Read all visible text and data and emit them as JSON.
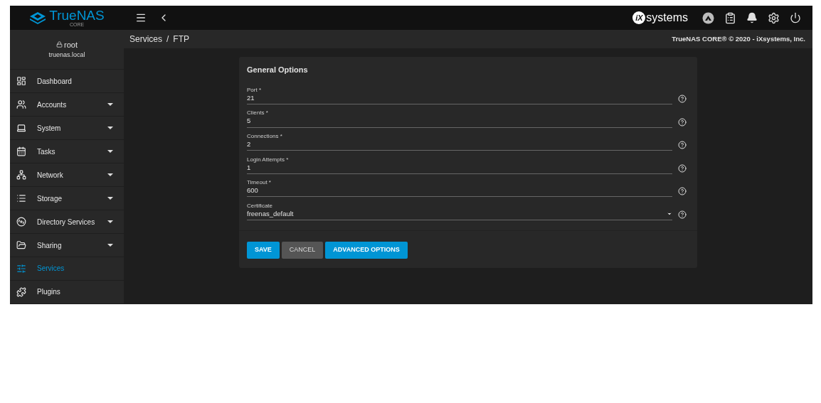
{
  "topbar": {
    "logo_text": "TrueNAS",
    "logo_subtext": "CORE",
    "vendor_text": "iX",
    "vendor_suffix": "systems"
  },
  "user": {
    "name": "root",
    "host": "truenas.local"
  },
  "sidebar": {
    "items": [
      {
        "label": "Dashboard",
        "has_submenu": false,
        "selected": false
      },
      {
        "label": "Accounts",
        "has_submenu": true,
        "selected": false
      },
      {
        "label": "System",
        "has_submenu": true,
        "selected": false
      },
      {
        "label": "Tasks",
        "has_submenu": true,
        "selected": false
      },
      {
        "label": "Network",
        "has_submenu": true,
        "selected": false
      },
      {
        "label": "Storage",
        "has_submenu": true,
        "selected": false
      },
      {
        "label": "Directory Services",
        "has_submenu": true,
        "selected": false
      },
      {
        "label": "Sharing",
        "has_submenu": true,
        "selected": false
      },
      {
        "label": "Services",
        "has_submenu": false,
        "selected": true
      },
      {
        "label": "Plugins",
        "has_submenu": false,
        "selected": false
      }
    ]
  },
  "breadcrumb": {
    "separator": "/",
    "items": [
      "Services",
      "FTP"
    ]
  },
  "copyright": "TrueNAS CORE® © 2020 - iXsystems, Inc.",
  "form": {
    "title": "General Options",
    "fields": [
      {
        "kind": "input",
        "label": "Port *",
        "value": "21"
      },
      {
        "kind": "input",
        "label": "Clients *",
        "value": "5"
      },
      {
        "kind": "input",
        "label": "Connections *",
        "value": "2"
      },
      {
        "kind": "input",
        "label": "Login Attempts *",
        "value": "1"
      },
      {
        "kind": "input",
        "label": "Timeout *",
        "value": "600"
      },
      {
        "kind": "select",
        "label": "Certificate",
        "value": "freenas_default"
      }
    ],
    "buttons": [
      {
        "kind": "primary",
        "label": "SAVE"
      },
      {
        "kind": "secondary",
        "label": "CANCEL"
      },
      {
        "kind": "primary",
        "label": "ADVANCED OPTIONS"
      }
    ]
  }
}
